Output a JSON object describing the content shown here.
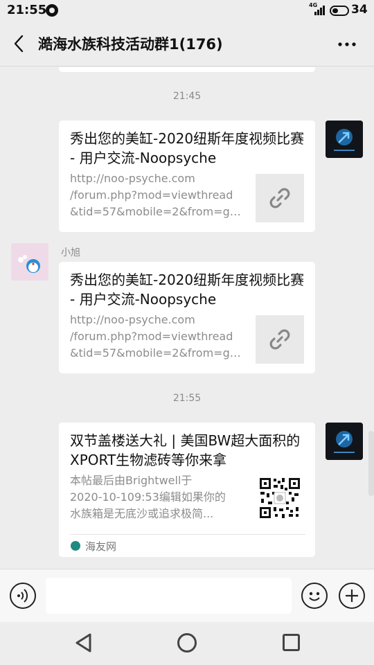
{
  "status_bar": {
    "time": "21:55",
    "network": "4G",
    "battery": "34"
  },
  "header": {
    "title": "澔海水族科技活动群1(176)"
  },
  "messages": [
    {
      "type": "time",
      "text": "21:45"
    },
    {
      "type": "link-card",
      "sender": "self",
      "title": "秀出您的美缸-2020纽斯年度视频比赛 - 用户交流-Noopsyche",
      "desc_lines": [
        "http://noo-psyche.com",
        "/forum.php?mod=viewthread",
        "&tid=57&mobile=2&from=gr..."
      ],
      "thumb_icon": "link-icon"
    },
    {
      "type": "link-card",
      "sender": "other",
      "sender_name": "小旭",
      "title": "秀出您的美缸-2020纽斯年度视频比赛 - 用户交流-Noopsyche",
      "desc_lines": [
        "http://noo-psyche.com",
        "/forum.php?mod=viewthread",
        "&tid=57&mobile=2&from=gr..."
      ],
      "thumb_icon": "link-icon"
    },
    {
      "type": "time",
      "text": "21:55"
    },
    {
      "type": "article-card",
      "sender": "self",
      "title": "双节盖楼送大礼 | 美国BW超大面积的XPORT生物滤砖等你来拿",
      "desc_lines": [
        "本帖最后由Brightwell于",
        "2020-10-109:53编辑如果你的",
        "水族箱是无底沙或追求极简..."
      ],
      "thumb_icon": "qr-code-icon",
      "source": "海友网"
    }
  ],
  "input_bar": {
    "placeholder": ""
  },
  "colors": {
    "background": "#ededed",
    "card": "#ffffff",
    "muted_text": "#8c8c8c",
    "source_icon": "#1f8a83"
  }
}
